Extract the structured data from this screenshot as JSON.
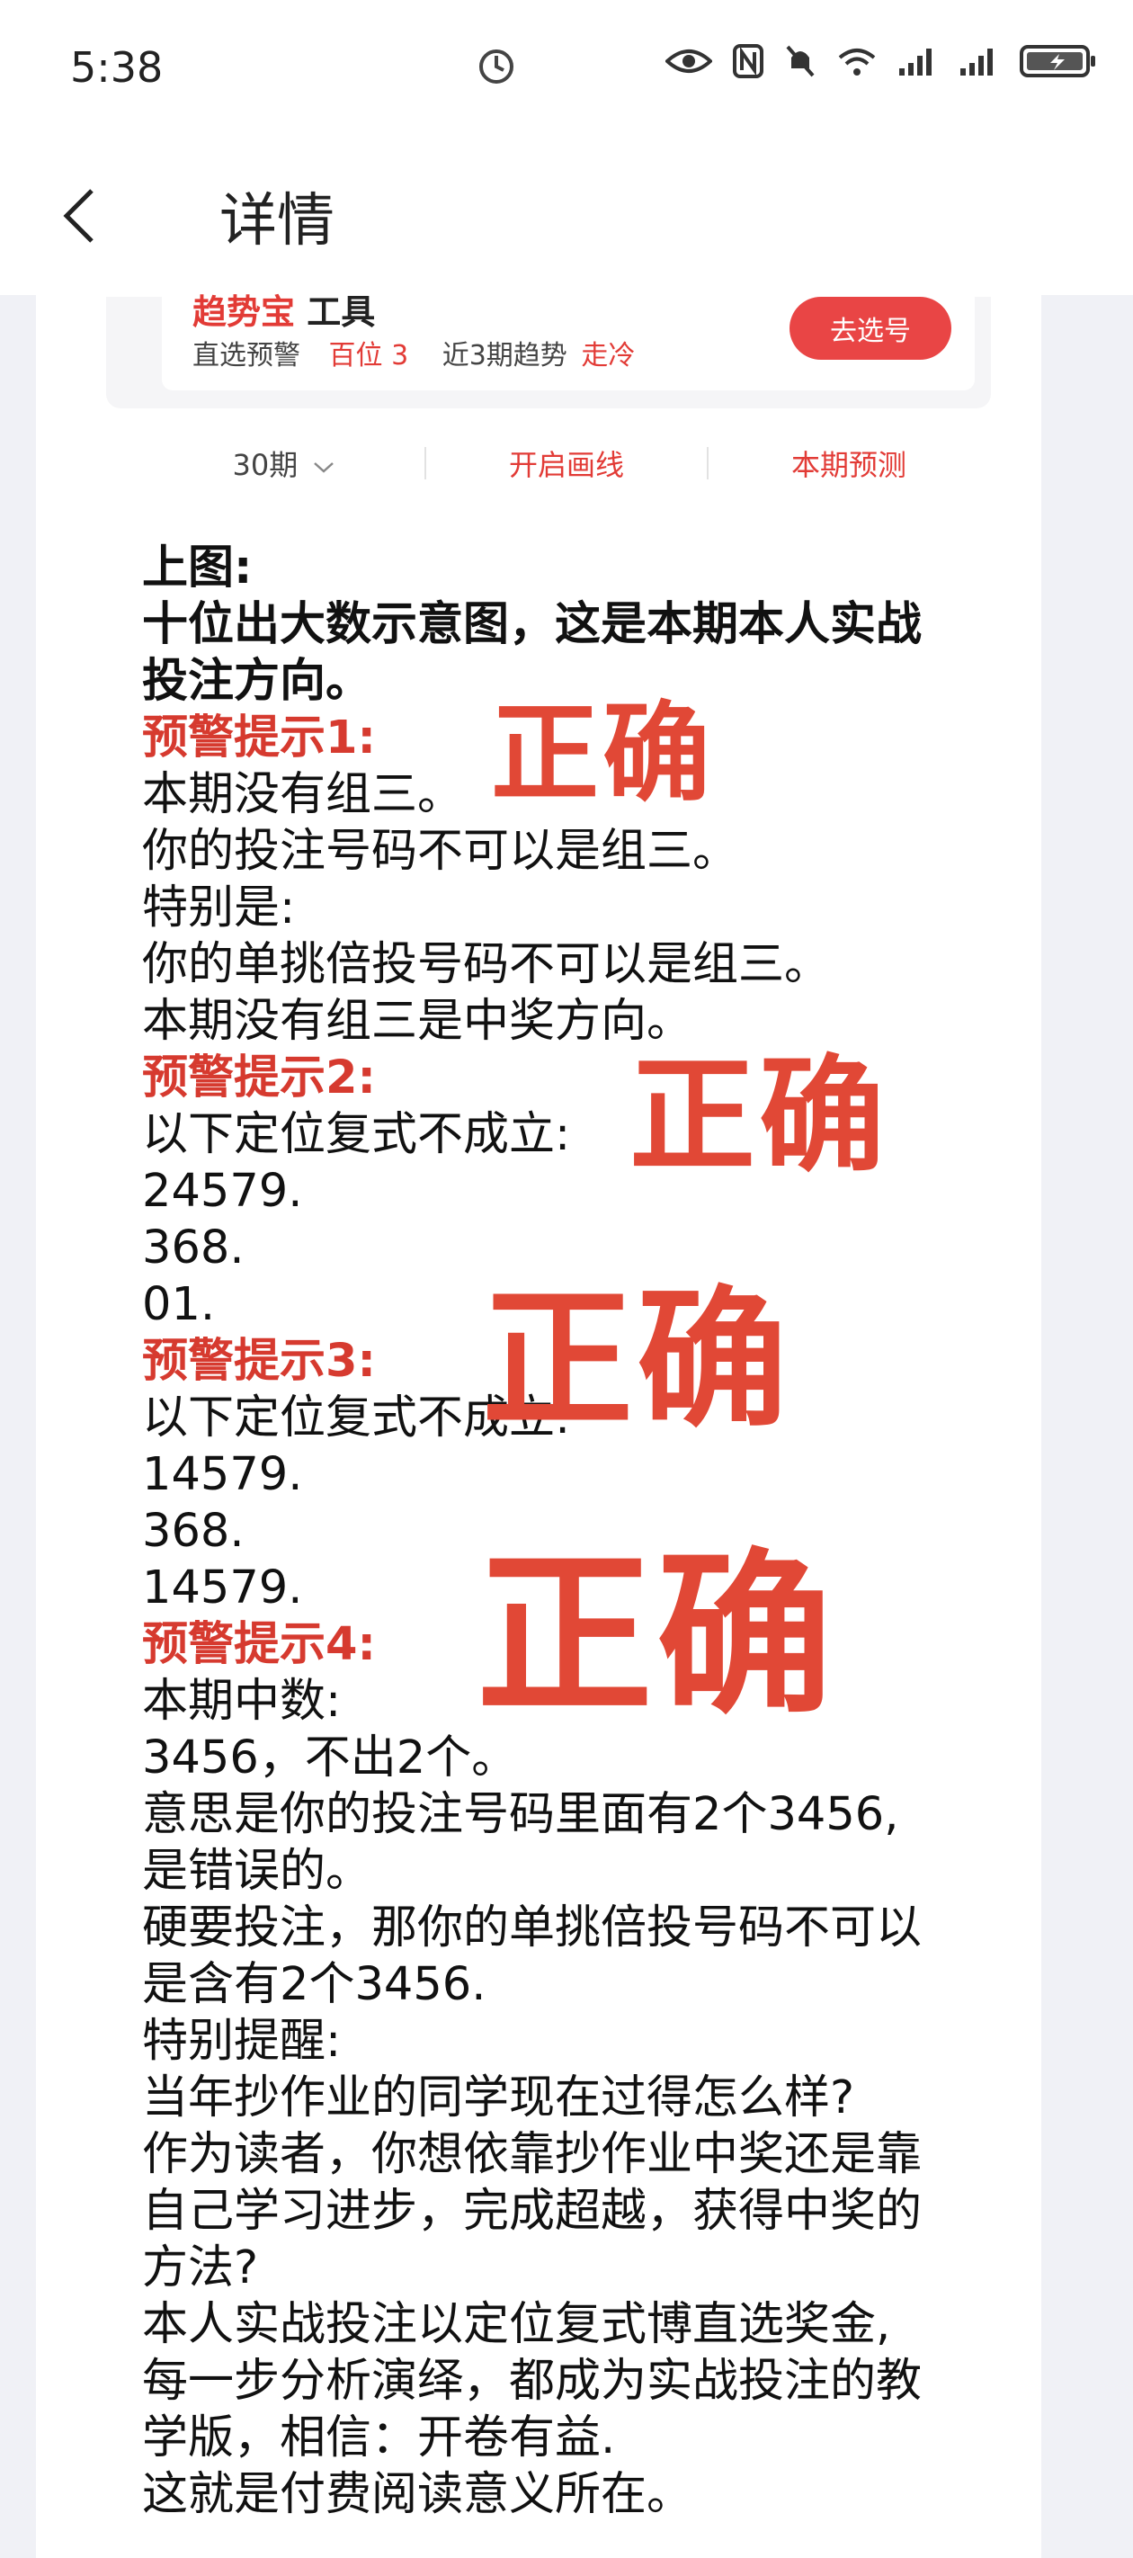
{
  "status": {
    "time": "5:38"
  },
  "header": {
    "title": "详情"
  },
  "tool_card": {
    "title_red": "趋势宝",
    "title_rest": " 工具",
    "row_prefix": "直选预警",
    "row_position": "百位 3",
    "row_trend_label": "近3期趋势",
    "row_trend_value": "走冷",
    "button_label": "去选号"
  },
  "tabs": {
    "period": "30期",
    "draw_line": "开启画线",
    "forecast": "本期预测"
  },
  "article": {
    "lines": [
      "上图:",
      "十位出大数示意图，这是本期本人实战",
      "投注方向。",
      "预警提示1:",
      "本期没有组三。",
      "你的投注号码不可以是组三。",
      "特别是:",
      "你的单挑倍投号码不可以是组三。",
      "本期没有组三是中奖方向。",
      "预警提示2:",
      "以下定位复式不成立:",
      "24579.",
      "368.",
      "01.",
      "预警提示3:",
      "以下定位复式不成立:",
      "14579.",
      "368.",
      "14579.",
      "预警提示4:",
      "本期中数:",
      "3456，不出2个。",
      "意思是你的投注号码里面有2个3456,",
      "是错误的。",
      "硬要投注，那你的单挑倍投号码不可以",
      "是含有2个3456.",
      "特别提醒:",
      "当年抄作业的同学现在过得怎么样?",
      "作为读者，你想依靠抄作业中奖还是靠",
      "自己学习进步，完成超越，获得中奖的",
      "方法?",
      "本人实战投注以定位复式博直选奖金,",
      "每一步分析演绎，都成为实战投注的教",
      "学版，相信：开卷有益.",
      "这就是付费阅读意义所在。"
    ]
  },
  "stamps": {
    "s1": "正确",
    "s2": "正确",
    "s3": "正确",
    "s4": "正确"
  },
  "colors": {
    "accent_red": "#e23b36",
    "stamp_red": "#e14836",
    "button_red": "#e94545"
  }
}
